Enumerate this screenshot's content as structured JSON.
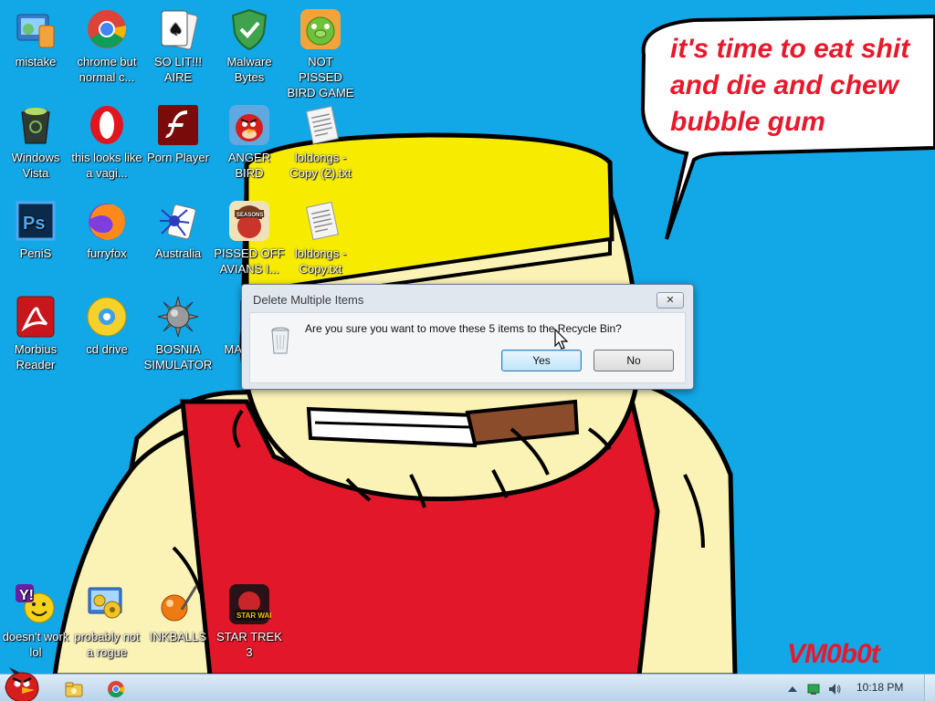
{
  "bubble": {
    "text": "it's time to eat shit\nand die and chew\nbubble gum"
  },
  "watermark": "VM0b0t",
  "desktop_icons": [
    {
      "label": "mistake",
      "icon": "control-panel-icon"
    },
    {
      "label": "chrome but normal c...",
      "icon": "chrome-icon"
    },
    {
      "label": "SO LIT!!! AIRE",
      "icon": "solitaire-icon"
    },
    {
      "label": "Malware Bytes",
      "icon": "shield-icon"
    },
    {
      "label": "NOT PISSED BIRD GAME",
      "icon": "green-pig-icon"
    },
    {
      "label": "Windows Vista",
      "icon": "recycle-bin-icon"
    },
    {
      "label": "this looks like a vagi...",
      "icon": "opera-icon"
    },
    {
      "label": "Porn Player",
      "icon": "flash-icon"
    },
    {
      "label": "ANGER BIRD",
      "icon": "angry-bird-icon"
    },
    {
      "label": "loldongs - Copy (2).txt",
      "icon": "text-file-icon"
    },
    {
      "label": "PeniS",
      "icon": "photoshop-icon"
    },
    {
      "label": "furryfox",
      "icon": "firefox-icon"
    },
    {
      "label": "Australia",
      "icon": "spider-solitaire-icon"
    },
    {
      "label": "PISSED OFF AVIANS I...",
      "icon": "angry-birds-seasons-icon"
    },
    {
      "label": "loldongs - Copy.txt",
      "icon": "text-file-icon"
    },
    {
      "label": "Morbius Reader",
      "icon": "acrobat-icon"
    },
    {
      "label": "cd drive",
      "icon": "cd-icon"
    },
    {
      "label": "BOSNIA SIMULATOR",
      "icon": "spiky-ball-icon"
    },
    {
      "label": "MAD UNI",
      "icon": "app-icon"
    },
    {
      "label": "doesn't work lol",
      "icon": "yahoo-messenger-icon"
    },
    {
      "label": "probably not a rogue",
      "icon": "system-settings-icon"
    },
    {
      "label": "INKBALLS",
      "icon": "inkball-icon"
    },
    {
      "label": "STAR TREK 3",
      "icon": "star-wars-birds-icon"
    }
  ],
  "dialog": {
    "title": "Delete Multiple Items",
    "close_label": "✕",
    "message": "Are you sure you want to move these 5 items to the Recycle Bin?",
    "yes_label": "Yes",
    "no_label": "No"
  },
  "taskbar": {
    "start_icon": "angry-bird-start-icon",
    "pinned": [
      "explorer-icon",
      "chrome-icon"
    ],
    "tray": [
      "arrow-up-icon",
      "network-icon",
      "volume-icon"
    ],
    "clock": "10:18 PM"
  },
  "colors": {
    "desktop": "#12a7e6",
    "bubble_text": "#e7192d",
    "shirt": "#e2182a",
    "hat": "#f7ec00",
    "skin": "#fbf2b6"
  }
}
